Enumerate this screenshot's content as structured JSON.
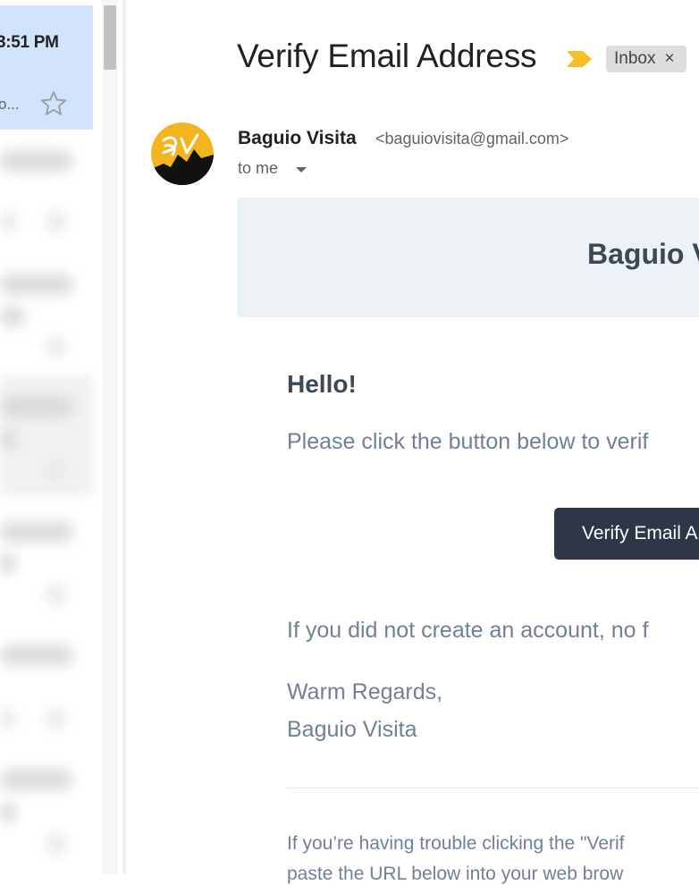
{
  "message_list": {
    "selected_item": {
      "time": "3:51 PM",
      "snippet": "o...",
      "star_icon": "star-outline-icon"
    }
  },
  "message": {
    "subject": "Verify Email Address",
    "importance_icon": "importance-marker-icon",
    "label": {
      "text": "Inbox",
      "remove": "×"
    },
    "sender": {
      "name": "Baguio Visita",
      "email": "<baguiovisita@gmail.com>",
      "avatar_initials": "BV"
    },
    "recipient_summary": "to me"
  },
  "email_body": {
    "banner_title": "Baguio V",
    "greeting": "Hello!",
    "instruction": "Please click the button below to verif",
    "button_label": "Verify Email A",
    "no_account_note": "If you did not create an account, no f",
    "signoff": "Warm Regards,",
    "signature": "Baguio Visita",
    "footer_note": "If you’re having trouble clicking the \"Verif",
    "footer_note_cut": "paste the URL below into your web brow"
  },
  "colors": {
    "selected_row": "#d2e3fc",
    "banner_bg": "#edf2f7",
    "button_bg": "#2d3748",
    "body_text": "#718096",
    "heading_text": "#3d4852",
    "importance": "#f4b400"
  }
}
